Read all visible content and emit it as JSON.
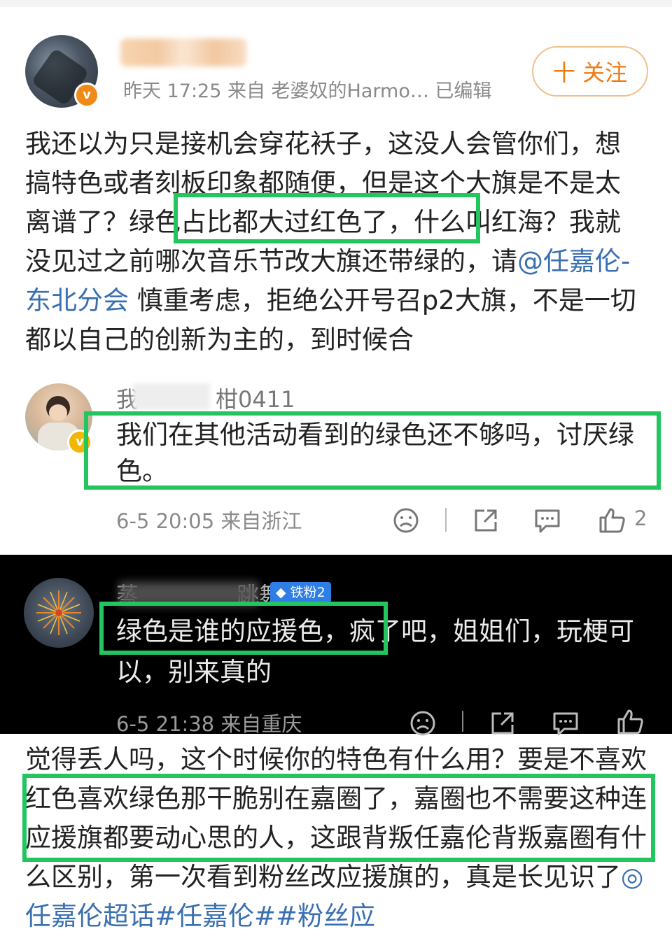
{
  "post": {
    "meta": "昨天 17:25  来自 老婆奴的Harmo…  已编辑",
    "follow_label": "十 关注",
    "text_a": "我还以为只是接机会穿花袄子，这没人会管你们，想搞特色或者刻板印象都随便，但是这个大旗是不是太离谱了？",
    "text_hl": "绿色占比都大过红色了",
    "text_b": "，什么叫红海？我就没见过之前哪次音乐节改大旗还带绿的，请",
    "mention": "@任嘉伦-东北分会",
    "text_c": " 慎重考虑，拒绝公开号召p2大旗，不是一切都以自己的创新为主的，到时候合"
  },
  "comment1": {
    "name": "我",
    "name_suffix": "柑0411",
    "text": "我们在其他活动看到的绿色还不够吗，讨厌绿色。",
    "meta": "6-5 20:05  来自浙江",
    "like_count": "2"
  },
  "comment2": {
    "name": "蒸",
    "name_suffix": "跳舞",
    "badge": "铁粉2",
    "text_hl": "绿色是谁的应援色，",
    "text": "疯了吧，姐姐们，玩梗可以，别来真的",
    "meta": "6-5 21:38  来自重庆"
  },
  "post_continued": {
    "text_a": "觉得丢人吗，这个时候你的特色有什么用？要是不",
    "text_hl": "喜欢红色喜欢绿色那干脆别在嘉圈了，嘉圈也不需要这种连应援旗都要动心思的人，这跟背叛任嘉伦",
    "text_b": "背叛嘉圈有什么区别，第一次看到粉丝改应援旗的，真是长见识了",
    "hashtags": "◎任嘉伦超话#任嘉伦##粉丝应"
  },
  "icons": [
    "dislike-icon",
    "share-icon",
    "comment-icon",
    "like-icon"
  ],
  "colors": {
    "highlight": "#22c55e",
    "link": "#3a6fb0",
    "follow": "#f27a12",
    "badge": "#2f7ee6"
  }
}
